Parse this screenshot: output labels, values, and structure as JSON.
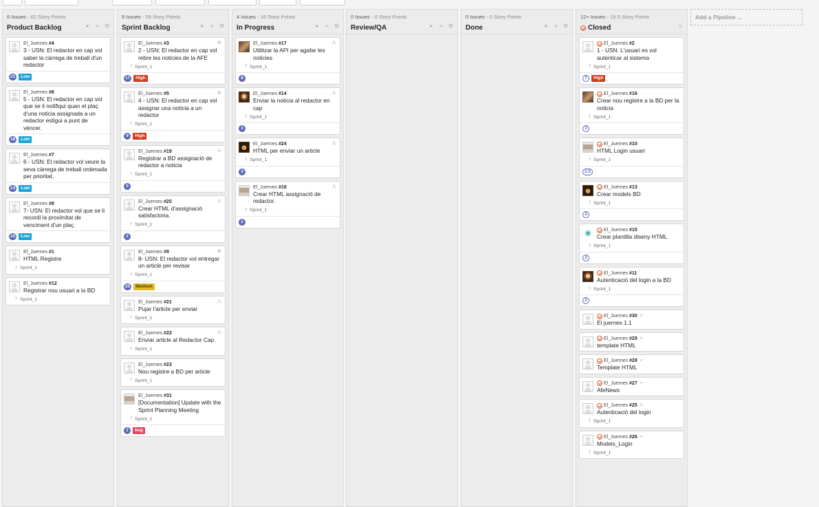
{
  "colors": {
    "accent": "#5a67b8",
    "low": "#1aa3d4",
    "high": "#d13b1f",
    "medium": "#e2b92a",
    "bug": "#e0465a",
    "closed": "#d35a2a"
  },
  "icons": {
    "play": "play-icon",
    "rewind": "collapse-icon",
    "settings": "gear-icon",
    "block": "blocked-icon",
    "warn": "warning-icon",
    "sprint": "milestone-pin-icon",
    "pr": "pull-request-icon",
    "closed": "closed-status-icon"
  },
  "add_pipeline": "Add a Pipeline ...",
  "pipelines": [
    {
      "issues": "6 Issues",
      "points": "- 62 Story Points",
      "title": "Product Backlog",
      "cards": [
        {
          "user": "El_Juernes",
          "num": "#4",
          "title": "3 - USN: El redactor en cap vol saber la càrrega de treball d'un redactor",
          "sprint": "",
          "est": "21",
          "label": "Low",
          "labelColor": "#1aa3d4"
        },
        {
          "user": "El_Juernes",
          "num": "#6",
          "title": "5 - USN: El redactor en cap vol que se li notifiqui quan el plaç d'una noticia assignada a un redactor estigui a punt de vèncer.",
          "sprint": "",
          "est": "18",
          "label": "Low",
          "labelColor": "#1aa3d4"
        },
        {
          "user": "El_Juernes",
          "num": "#7",
          "title": "6 - USN: El redactor vol veure la seva càrrega de treball ordenada per prioritat.",
          "sprint": "",
          "est": "13",
          "label": "Low",
          "labelColor": "#1aa3d4"
        },
        {
          "user": "El_Juernes",
          "num": "#8",
          "title": "7- USN: El redactor vol que se li recordi la proximitat de venciment d'un plaç.",
          "sprint": "",
          "est": "10",
          "label": "Low",
          "labelColor": "#1aa3d4"
        },
        {
          "user": "El_Juernes",
          "num": "#1",
          "title": "HTML Registre",
          "sprint": "Sprint_1",
          "est": "",
          "label": ""
        },
        {
          "user": "El_Juernes",
          "num": "#12",
          "title": "Registrar nou usuari a la BD",
          "sprint": "Sprint_1",
          "est": "",
          "label": ""
        }
      ]
    },
    {
      "issues": "9 Issues",
      "points": "- 59 Story Points",
      "title": "Sprint Backlog",
      "cards": [
        {
          "user": "El_Juernes",
          "num": "#3",
          "title": "2 - USN: El redactor en cap vol rebre les noticies de la AFE",
          "sprint": "Sprint_1",
          "est": "17",
          "label": "High",
          "labelColor": "#d13b1f",
          "corner": "⊘"
        },
        {
          "user": "El_Juernes",
          "num": "#5",
          "title": "4 - USN: El redactor en cap vol assignar una noticia a un redactor",
          "sprint": "Sprint_1",
          "est": "9",
          "label": "High",
          "labelColor": "#d13b1f",
          "corner": "⊘"
        },
        {
          "user": "El_Juernes",
          "num": "#19",
          "title": "Registrar a BD assignació de redactor a noticia",
          "sprint": "Sprint_1",
          "est": "5",
          "label": "",
          "corner": "⚠"
        },
        {
          "user": "El_Juernes",
          "num": "#20",
          "title": "Crear HTML d'assignació satisfactoria.",
          "sprint": "Sprint_1",
          "est": "2",
          "label": "",
          "corner": "⚠"
        },
        {
          "user": "El_Juernes",
          "num": "#9",
          "title": "8- USN: El redactor vol entregar un article per revisar",
          "sprint": "Sprint_1",
          "est": "25",
          "label": "Medium",
          "labelColor": "#e2b92a",
          "corner": "⊘"
        },
        {
          "user": "El_Juernes",
          "num": "#21",
          "title": "Pujar l'article per enviar",
          "sprint": "Sprint_1",
          "est": "",
          "label": "",
          "corner": "⚠"
        },
        {
          "user": "El_Juernes",
          "num": "#22",
          "title": "Enviar article al Redactor Cap",
          "sprint": "Sprint_1",
          "est": "",
          "label": "",
          "corner": "⚠"
        },
        {
          "user": "El_Juernes",
          "num": "#23",
          "title": "Nou registre a BD per article",
          "sprint": "Sprint_1",
          "est": "",
          "label": ""
        },
        {
          "user": "El_Juernes",
          "num": "#31",
          "title": "[Documentation] Update with the Sprint Planning Meeting",
          "sprint": "Sprint_1",
          "est": "1",
          "label": "bug",
          "labelColor": "#e0465a",
          "avatar": "photo4"
        }
      ]
    },
    {
      "issues": "4 Issues",
      "points": "- 16 Story Points",
      "title": "In Progress",
      "cards": [
        {
          "user": "El_Juernes",
          "num": "#17",
          "title": "Utilitzar la API per agafar les noticies",
          "sprint": "Sprint_1",
          "est": "8",
          "label": "",
          "corner": "⚠",
          "avatar": "photo1"
        },
        {
          "user": "El_Juernes",
          "num": "#14",
          "title": "Enviar la noticia al redactor en cap",
          "sprint": "Sprint_1",
          "est": "3",
          "label": "",
          "corner": "⚠",
          "avatar": "photo2"
        },
        {
          "user": "El_Juernes",
          "num": "#24",
          "title": "HTML per enviar un article",
          "sprint": "Sprint_1",
          "est": "3",
          "label": "",
          "corner": "⚠",
          "avatar": "photo3"
        },
        {
          "user": "El_Juernes",
          "num": "#18",
          "title": "Crear HTML assignació de redactor.",
          "sprint": "Sprint_1",
          "est": "2",
          "label": "",
          "corner": "⚠",
          "avatar": "photo4"
        }
      ]
    },
    {
      "issues": "0 Issues",
      "points": "- 0 Story Points",
      "title": "Review/QA",
      "cards": []
    },
    {
      "issues": "0 Issues",
      "points": "- 0 Story Points",
      "title": "Done",
      "cards": []
    },
    {
      "issues": "12+ Issues",
      "points": "- 19.5 Story Points",
      "title": "Closed",
      "closed": true,
      "cards": [
        {
          "user": "El_Juernes",
          "num": "#2",
          "title": "1 - USN: L'usuari es vol autenticar al sistema",
          "sprint": "Sprint_1",
          "est": "7",
          "estOutline": true,
          "label": "High",
          "labelColor": "#d13b1f"
        },
        {
          "user": "El_Juernes",
          "num": "#16",
          "title": "Crear nou registre a la BD per la noticia",
          "sprint": "Sprint_1",
          "est": "3",
          "estOutline": true,
          "label": "",
          "avatar": "photo1"
        },
        {
          "user": "El_Juernes",
          "num": "#10",
          "title": "HTML Login usuari",
          "sprint": "Sprint_1",
          "est": "2.5",
          "estOutline": true,
          "label": "",
          "avatar": "photo4"
        },
        {
          "user": "El_Juernes",
          "num": "#13",
          "title": "Crear models BD",
          "sprint": "Sprint_1",
          "est": "3",
          "estOutline": true,
          "label": "",
          "avatar": "photo3"
        },
        {
          "user": "El_Juernes",
          "num": "#15",
          "title": "Crear plantilla diseny HTML",
          "sprint": "Sprint_1",
          "est": "2",
          "estOutline": true,
          "label": "",
          "avatar": "teal"
        },
        {
          "user": "El_Juernes",
          "num": "#11",
          "title": "Autenticació del login a la BD",
          "sprint": "Sprint_1",
          "est": "2",
          "estOutline": true,
          "label": "",
          "avatar": "photo2"
        },
        {
          "user": "El_Juernes",
          "num": "#30",
          "title": "El juernes 1.1",
          "sprint": "",
          "est": "",
          "label": "",
          "pr": true
        },
        {
          "user": "El_Juernes",
          "num": "#29",
          "title": "template HTML",
          "sprint": "",
          "est": "",
          "label": "",
          "pr": true
        },
        {
          "user": "El_Juernes",
          "num": "#28",
          "title": "Template HTML",
          "sprint": "",
          "est": "",
          "label": "",
          "pr": true
        },
        {
          "user": "El_Juernes",
          "num": "#27",
          "title": "AfeNews",
          "sprint": "",
          "est": "",
          "label": "",
          "pr": true
        },
        {
          "user": "El_Juernes",
          "num": "#25",
          "title": "Autenticació del login",
          "sprint": "Sprint_1",
          "est": "",
          "label": "",
          "pr": true
        },
        {
          "user": "El_Juernes",
          "num": "#26",
          "title": "Models_Login",
          "sprint": "Sprint_1",
          "est": "",
          "label": "",
          "pr": true
        }
      ]
    }
  ]
}
